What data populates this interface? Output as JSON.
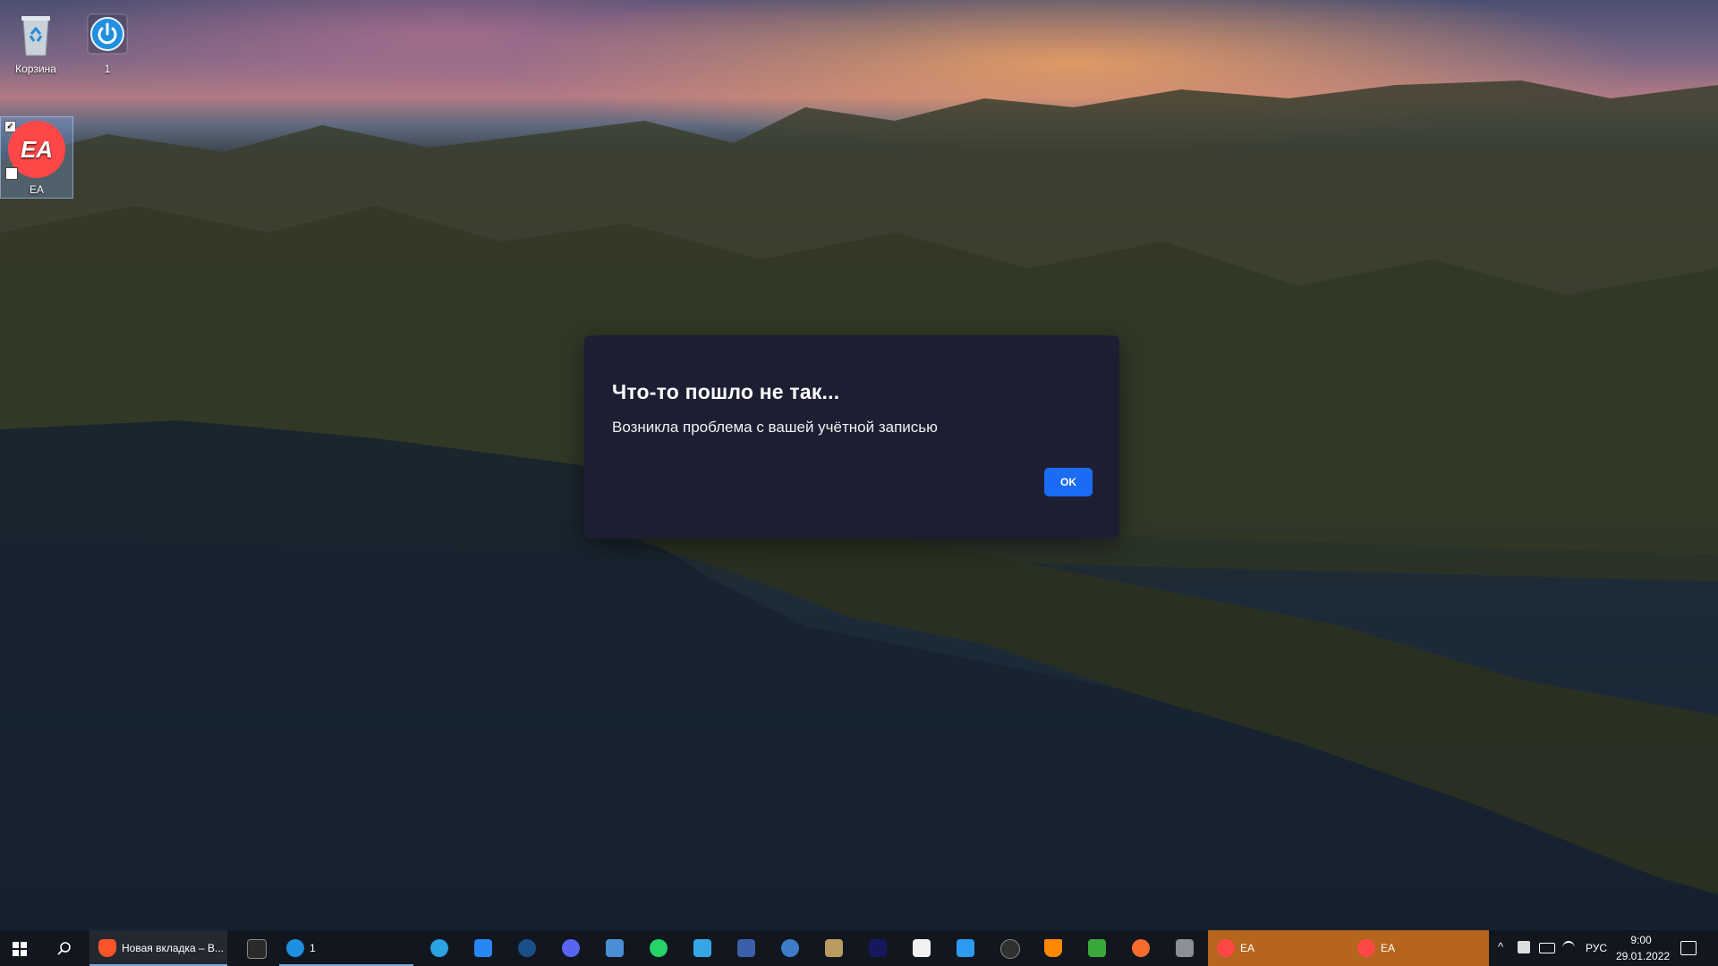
{
  "desktop": {
    "icons": [
      {
        "label": "Корзина"
      },
      {
        "label": "1"
      },
      {
        "label": "EA"
      }
    ]
  },
  "dialog": {
    "title": "Что-то пошло не так...",
    "message": "Возникла проблема с вашей учётной записью",
    "ok_label": "OK"
  },
  "taskbar": {
    "browser_tab_label": "Новая вкладка – B...",
    "app1_label": "1",
    "ea_window_1_label": "EA",
    "ea_window_2_label": "EA",
    "tray": {
      "language": "РУС",
      "time": "9:00",
      "date": "29.01.2022"
    },
    "pinned": [
      "telegram-icon",
      "vk-icon",
      "steam-icon",
      "discord-icon",
      "app-icon",
      "whatsapp-icon",
      "bag-icon",
      "monitor-icon",
      "qbittorrent-icon",
      "app-icon",
      "si-game-icon",
      "store-icon",
      "upload-icon",
      "obs-icon",
      "vlc-icon",
      "game-icon",
      "origin-icon",
      "calculator-icon"
    ]
  },
  "colors": {
    "dialog_bg": "#1e1e33",
    "ok_button": "#1a6cf5",
    "ea_red": "#ff4747",
    "taskbar_highlight": "#b5651d"
  }
}
